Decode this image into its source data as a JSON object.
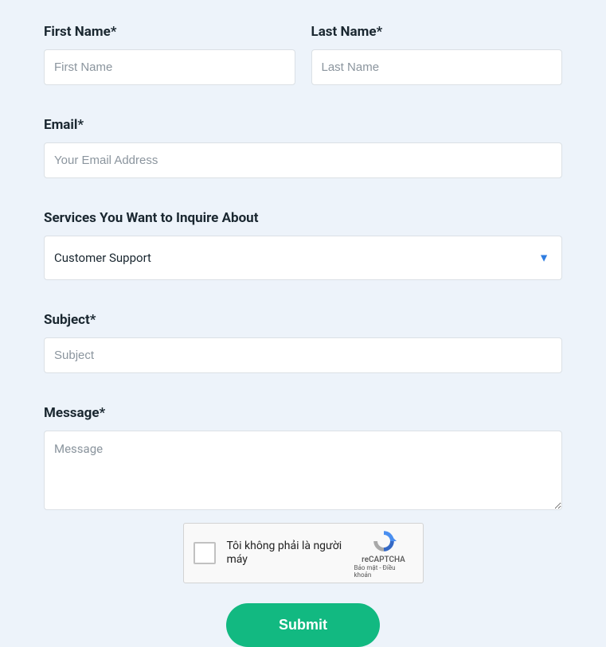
{
  "form": {
    "firstName": {
      "label": "First Name*",
      "placeholder": "First Name",
      "value": ""
    },
    "lastName": {
      "label": "Last Name*",
      "placeholder": "Last Name",
      "value": ""
    },
    "email": {
      "label": "Email*",
      "placeholder": "Your Email Address",
      "value": ""
    },
    "services": {
      "label": "Services You Want to Inquire About",
      "selected": "Customer Support"
    },
    "subject": {
      "label": "Subject*",
      "placeholder": "Subject",
      "value": ""
    },
    "message": {
      "label": "Message*",
      "placeholder": "Message",
      "value": ""
    }
  },
  "recaptcha": {
    "text": "Tôi không phải là người máy",
    "brand": "reCAPTCHA",
    "links": "Bảo mật - Điều khoản"
  },
  "submit": {
    "label": "Submit"
  }
}
